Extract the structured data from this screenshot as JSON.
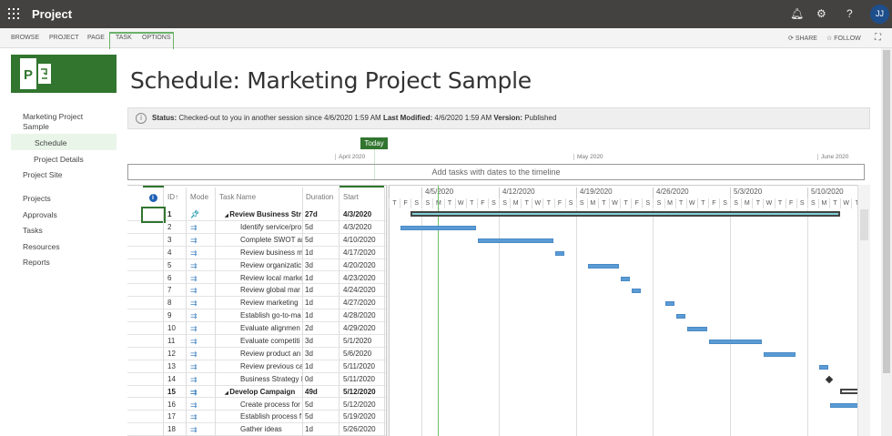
{
  "app": {
    "title": "Project",
    "avatar": "JJ"
  },
  "ribbon": {
    "tabs": [
      "BROWSE",
      "PROJECT",
      "PAGE",
      "TASK",
      "OPTIONS"
    ],
    "share": "SHARE",
    "follow": "FOLLOW"
  },
  "sidebar": {
    "project": "Marketing Project Sample",
    "items": [
      "Schedule",
      "Project Details",
      "Project Site",
      "Projects",
      "Approvals",
      "Tasks",
      "Resources",
      "Reports"
    ]
  },
  "page": {
    "title": "Schedule: Marketing Project Sample"
  },
  "status": {
    "label1": "Status:",
    "text1": "Checked-out to you in another session since 4/6/2020 1:59 AM",
    "label2": "Last Modified:",
    "text2": "4/6/2020 1:59 AM",
    "label3": "Version:",
    "text3": "Published"
  },
  "timeline": {
    "today": "Today",
    "months": [
      "April 2020",
      "May 2020",
      "June 2020"
    ],
    "placeholder": "Add tasks with dates to the timeline"
  },
  "grid": {
    "headers": {
      "id": "ID",
      "mode": "Mode",
      "name": "Task Name",
      "duration": "Duration",
      "start": "Start"
    },
    "rows": [
      {
        "id": "1",
        "name": "Review Business Str",
        "duration": "27d",
        "start": "4/3/2020",
        "summary": true,
        "manual": true
      },
      {
        "id": "2",
        "name": "Identify service/pro",
        "duration": "5d",
        "start": "4/3/2020"
      },
      {
        "id": "3",
        "name": "Complete SWOT an",
        "duration": "5d",
        "start": "4/10/2020"
      },
      {
        "id": "4",
        "name": "Review business m",
        "duration": "1d",
        "start": "4/17/2020"
      },
      {
        "id": "5",
        "name": "Review organizatic",
        "duration": "3d",
        "start": "4/20/2020"
      },
      {
        "id": "6",
        "name": "Review local marke",
        "duration": "1d",
        "start": "4/23/2020"
      },
      {
        "id": "7",
        "name": "Review global mar",
        "duration": "1d",
        "start": "4/24/2020"
      },
      {
        "id": "8",
        "name": "Review marketing",
        "duration": "1d",
        "start": "4/27/2020"
      },
      {
        "id": "9",
        "name": "Establish go-to-ma",
        "duration": "1d",
        "start": "4/28/2020"
      },
      {
        "id": "10",
        "name": "Evaluate alignmen",
        "duration": "2d",
        "start": "4/29/2020"
      },
      {
        "id": "11",
        "name": "Evaluate competiti",
        "duration": "3d",
        "start": "5/1/2020"
      },
      {
        "id": "12",
        "name": "Review product an",
        "duration": "3d",
        "start": "5/6/2020"
      },
      {
        "id": "13",
        "name": "Review previous ca",
        "duration": "1d",
        "start": "5/11/2020"
      },
      {
        "id": "14",
        "name": "Business Strategy I",
        "duration": "0d",
        "start": "5/11/2020"
      },
      {
        "id": "15",
        "name": "Develop Campaign",
        "duration": "49d",
        "start": "5/12/2020",
        "summary": true
      },
      {
        "id": "16",
        "name": "Create process for",
        "duration": "5d",
        "start": "5/12/2020"
      },
      {
        "id": "17",
        "name": "Establish process f",
        "duration": "5d",
        "start": "5/19/2020"
      },
      {
        "id": "18",
        "name": "Gather ideas",
        "duration": "1d",
        "start": "5/26/2020"
      }
    ]
  },
  "gantt": {
    "weeks": [
      "4/5/2020",
      "4/12/2020",
      "4/19/2020",
      "4/26/2020",
      "5/3/2020",
      "5/10/2020"
    ],
    "day_letters": [
      "S",
      "M",
      "T",
      "W",
      "T",
      "F",
      "S"
    ],
    "first_day": "4/2/2020",
    "today": "4/6/2020"
  },
  "colors": {
    "accent": "#31752f",
    "bar": "#5b9bd5",
    "summary_manual": "#7fd0d8"
  }
}
